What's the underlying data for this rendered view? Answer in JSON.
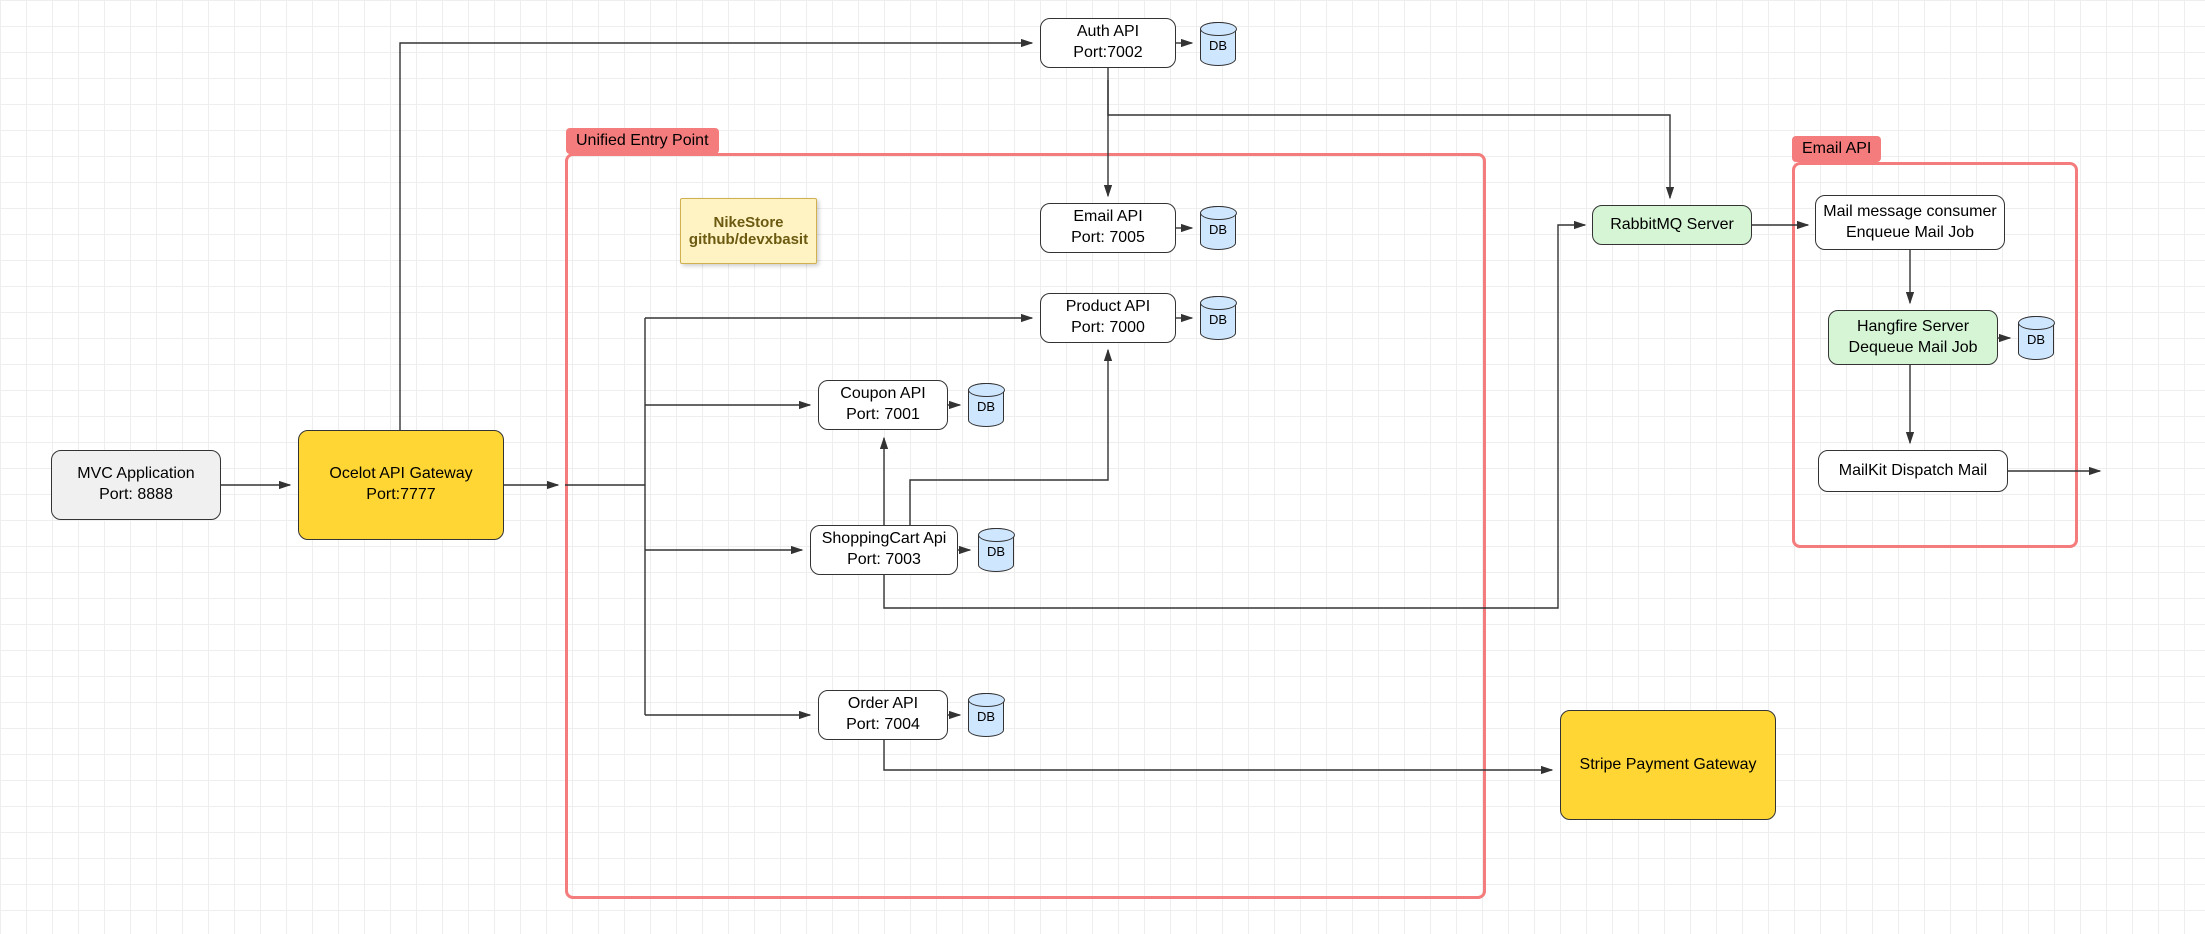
{
  "groups": {
    "uep": {
      "label": "Unified Entry Point"
    },
    "email": {
      "label": "Email API"
    }
  },
  "note": {
    "line1": "NikeStore",
    "line2": "github/devxbasit"
  },
  "nodes": {
    "mvc": {
      "line1": "MVC Application",
      "line2": "Port: 8888"
    },
    "ocelot": {
      "line1": "Ocelot API Gateway",
      "line2": "Port:7777"
    },
    "auth": {
      "line1": "Auth API",
      "line2": "Port:7002"
    },
    "emailapi": {
      "line1": "Email API",
      "line2": "Port: 7005"
    },
    "product": {
      "line1": "Product API",
      "line2": "Port: 7000"
    },
    "coupon": {
      "line1": "Coupon API",
      "line2": "Port: 7001"
    },
    "cart": {
      "line1": "ShoppingCart Api",
      "line2": "Port: 7003"
    },
    "order": {
      "line1": "Order API",
      "line2": "Port: 7004"
    },
    "rabbit": {
      "line1": "RabbitMQ Server"
    },
    "consumer": {
      "line1": "Mail message consumer",
      "line2": "Enqueue Mail Job"
    },
    "hangfire": {
      "line1": "Hangfire Server",
      "line2": "Dequeue Mail Job"
    },
    "mailkit": {
      "line1": "MailKit Dispatch Mail"
    },
    "stripe": {
      "line1": "Stripe Payment Gateway"
    }
  },
  "db_label": "DB"
}
